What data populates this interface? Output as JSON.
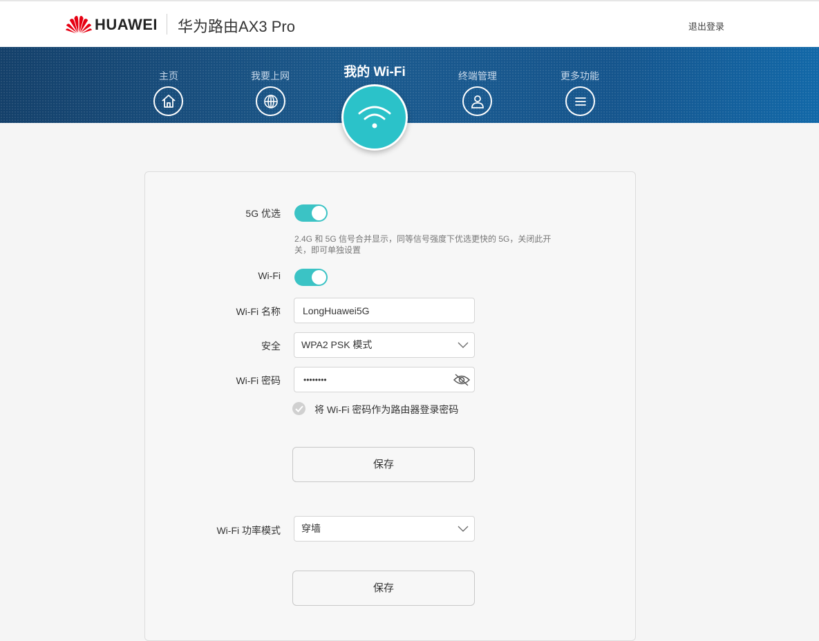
{
  "header": {
    "brand": "HUAWEI",
    "product": "华为路由AX3 Pro",
    "logout": "退出登录"
  },
  "nav": {
    "items": [
      {
        "label": "主页",
        "icon": "home-icon"
      },
      {
        "label": "我要上网",
        "icon": "globe-icon"
      },
      {
        "label": "我的 Wi-Fi",
        "icon": "wifi-icon",
        "active": true
      },
      {
        "label": "终端管理",
        "icon": "user-icon"
      },
      {
        "label": "更多功能",
        "icon": "menu-icon"
      }
    ]
  },
  "form": {
    "band_priority": {
      "label": "5G 优选",
      "on": true,
      "hint": "2.4G 和 5G 信号合并显示，同等信号强度下优选更快的 5G，关闭此开关，即可单独设置"
    },
    "wifi": {
      "label": "Wi-Fi",
      "on": true
    },
    "ssid": {
      "label": "Wi-Fi 名称",
      "value": "LongHuawei5G"
    },
    "security": {
      "label": "安全",
      "value": "WPA2 PSK 模式"
    },
    "password": {
      "label": "Wi-Fi 密码",
      "value": "••••••••"
    },
    "use_as_login": {
      "label": "将 Wi-Fi 密码作为路由器登录密码",
      "checked": false
    },
    "save1": "保存",
    "power_mode": {
      "label": "Wi-Fi 功率模式",
      "value": "穿墙"
    },
    "save2": "保存"
  },
  "colors": {
    "accent": "#2bc2c9",
    "toggle": "#3bc3c5",
    "nav_band": "#1a5386",
    "brand_red": "#e60012"
  }
}
